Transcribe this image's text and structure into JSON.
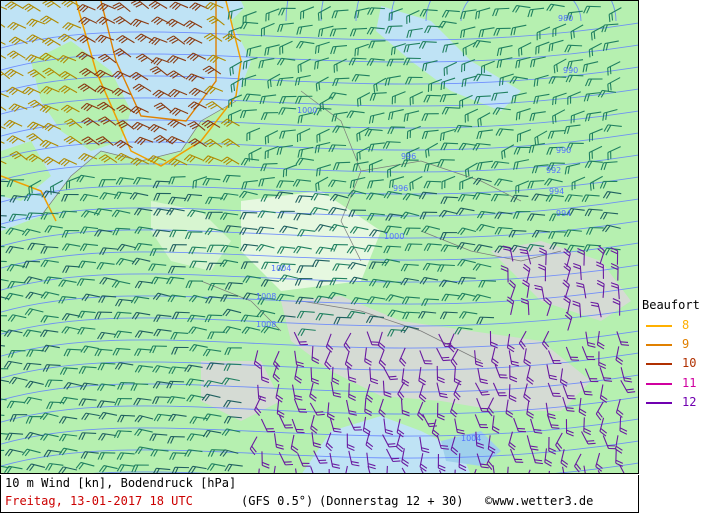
{
  "legend": {
    "title": "Beaufort",
    "items": [
      {
        "label": "8",
        "color": "#ffb000"
      },
      {
        "label": "9",
        "color": "#e08000"
      },
      {
        "label": "10",
        "color": "#b03000"
      },
      {
        "label": "11",
        "color": "#d000a0"
      },
      {
        "label": "12",
        "color": "#7000b0"
      }
    ]
  },
  "caption": {
    "parameter": "10 m Wind [kn], Bodendruck [hPa]",
    "valid_time": "Freitag, 13-01-2017  18 UTC",
    "model": "(GFS 0.5°)",
    "run": "(Donnerstag 12 + 30)",
    "copyright": "©www.wetter3.de"
  },
  "isobars": {
    "labels": [
      "1008",
      "1008",
      "1004",
      "1000",
      "1000",
      "996",
      "996",
      "992",
      "994",
      "990",
      "990",
      "980",
      "994",
      "1004"
    ]
  },
  "colors": {
    "sea": "#bfe3f5",
    "land": "#b6f0b0",
    "mountain": "#d8d8d8",
    "isobar": "#6080ff",
    "barb_low": "#208060",
    "barb_mid": "#206060",
    "barb_high": "#6a1aa0",
    "gale_contour": "#f0a000"
  }
}
